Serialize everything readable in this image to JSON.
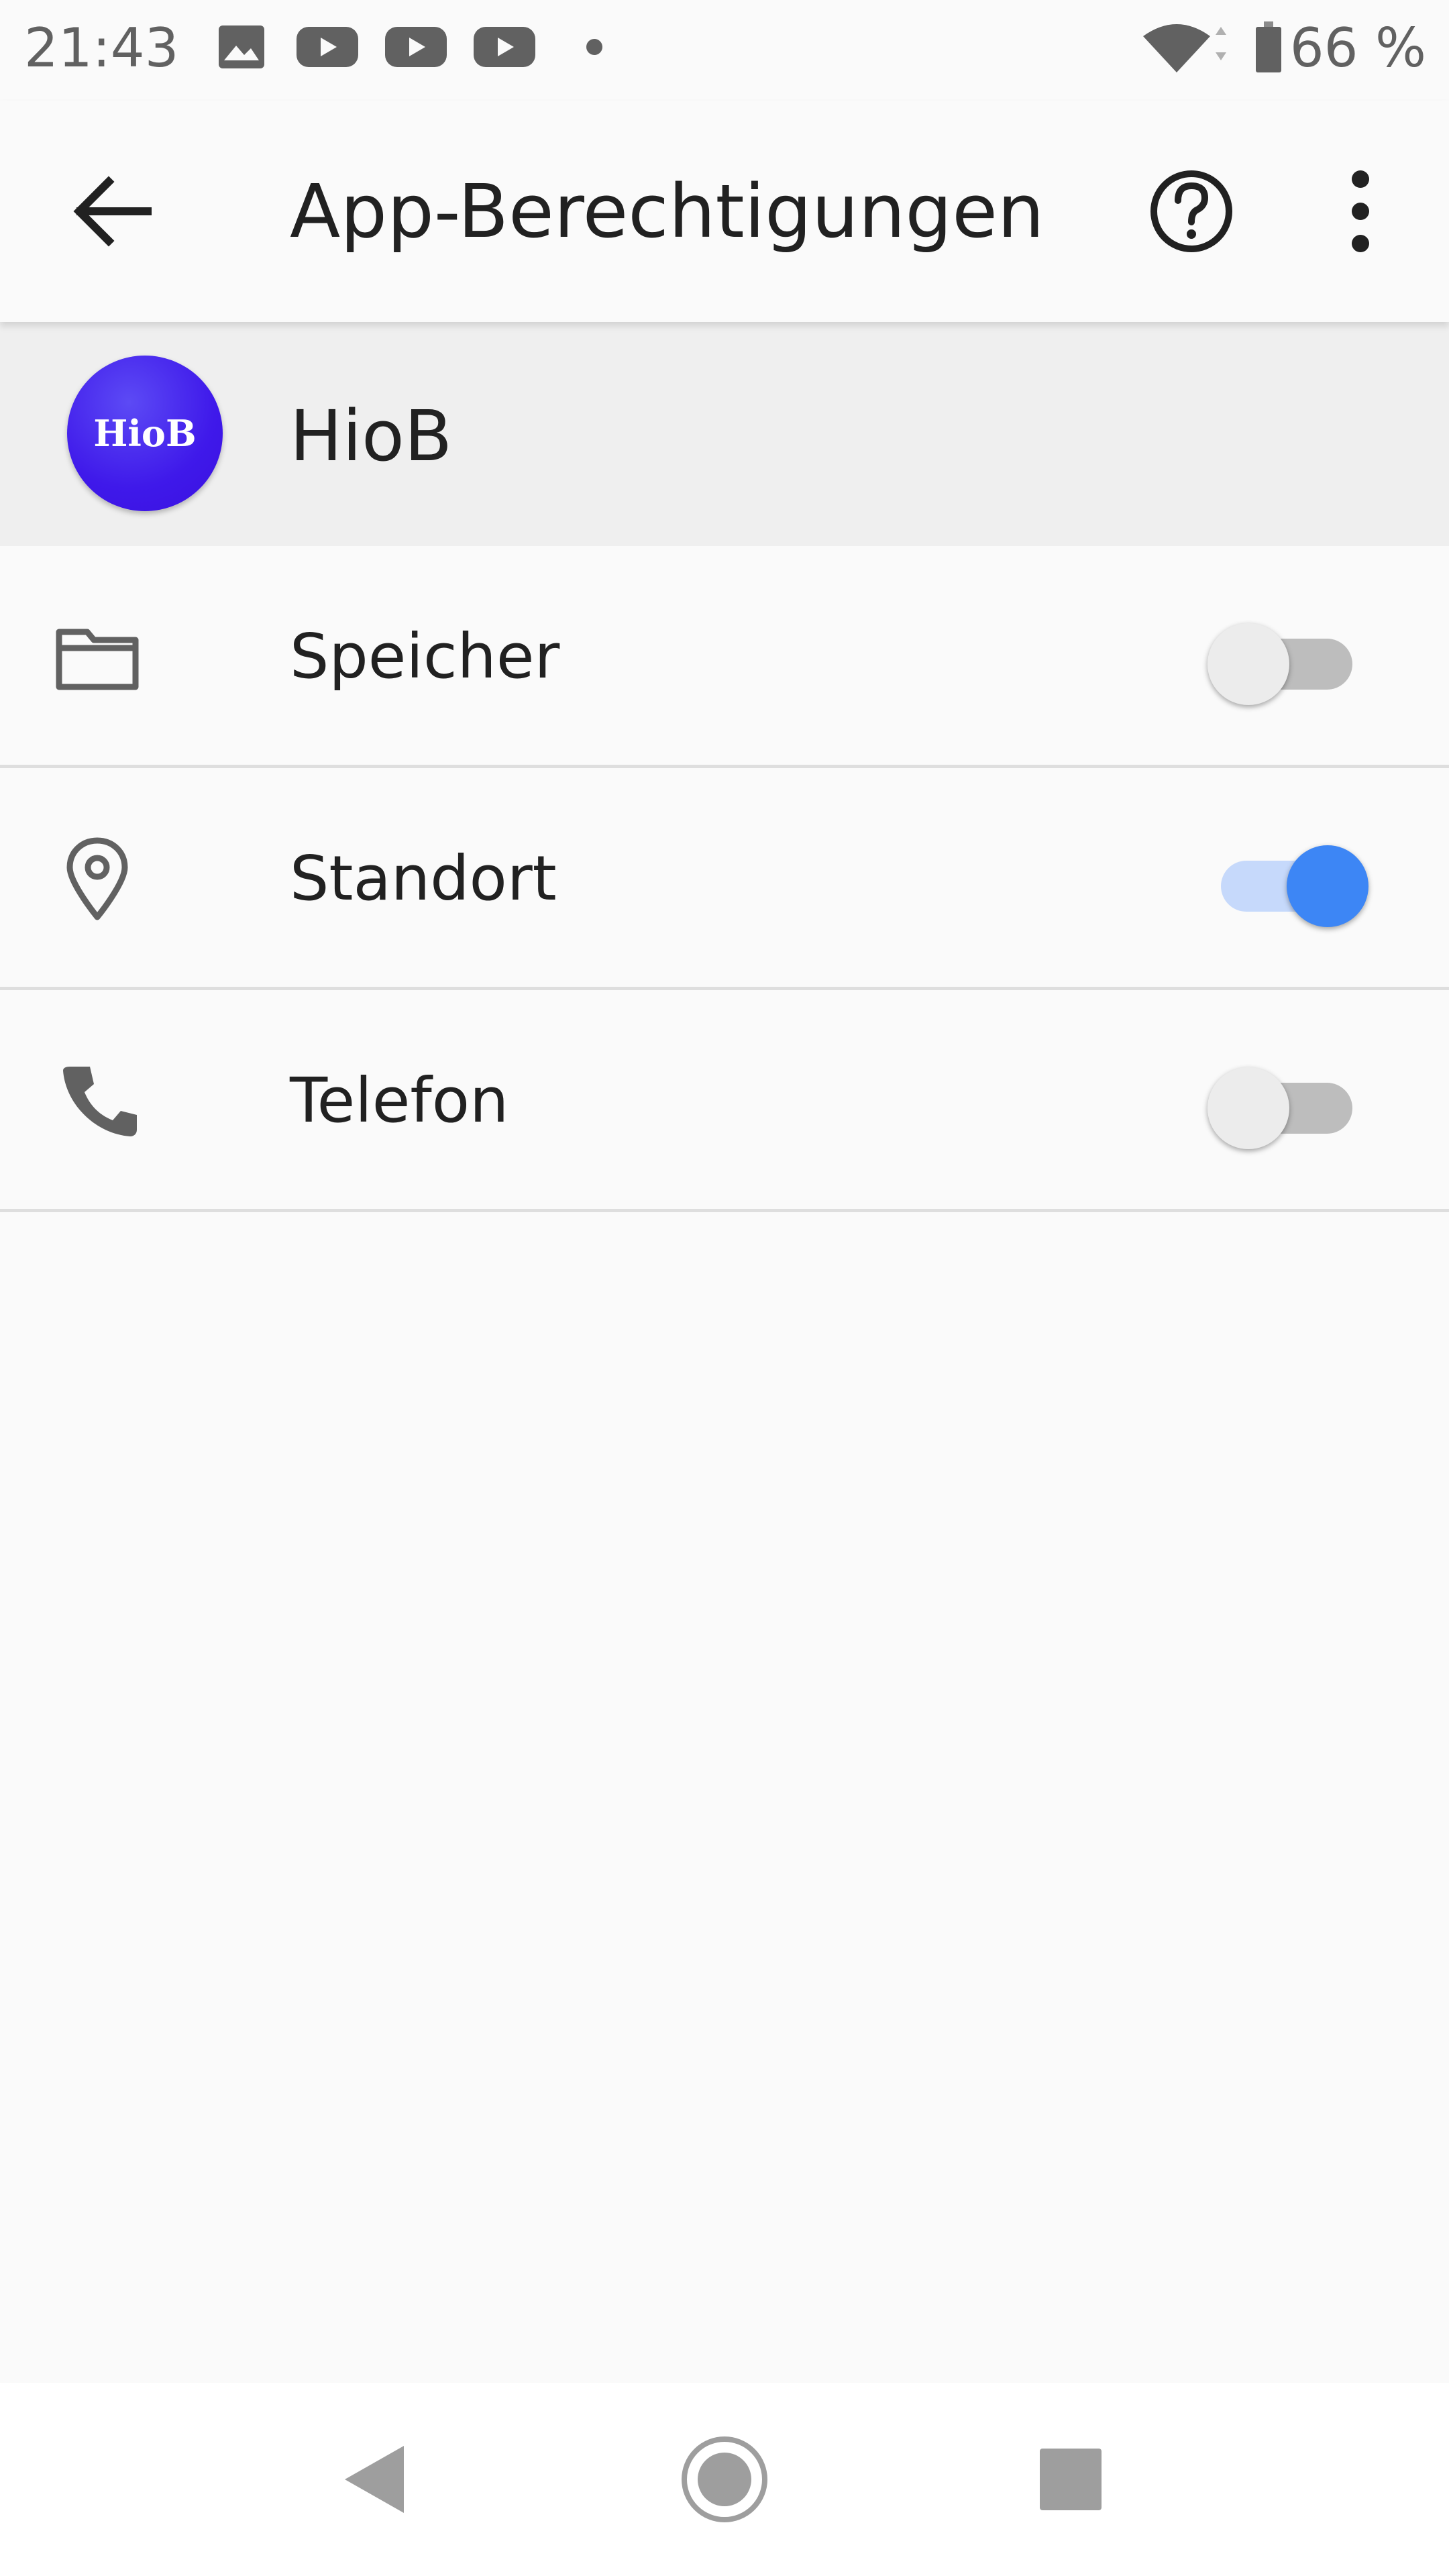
{
  "status_bar": {
    "time": "21:43",
    "battery_text": "66 %",
    "icons": [
      "image-icon",
      "youtube-icon",
      "youtube-icon",
      "youtube-icon",
      "dot-icon",
      "wifi-icon",
      "battery-icon"
    ]
  },
  "app_bar": {
    "title": "App-Berechtigungen",
    "back_icon": "arrow-back-icon",
    "help_icon": "help-circle-icon",
    "more_icon": "more-vert-icon"
  },
  "app": {
    "name": "HioB",
    "avatar_text": "HioB",
    "avatar_color": "#3f19ea"
  },
  "permissions": [
    {
      "label": "Speicher",
      "icon": "folder-icon",
      "enabled": false
    },
    {
      "label": "Standort",
      "icon": "location-pin-icon",
      "enabled": true
    },
    {
      "label": "Telefon",
      "icon": "phone-icon",
      "enabled": false
    }
  ],
  "nav_bar": {
    "buttons": [
      "nav-back-icon",
      "nav-home-icon",
      "nav-recents-icon"
    ]
  },
  "colors": {
    "accent": "#3d86f5",
    "accent_track": "#c6d9fb",
    "background": "#fafafa",
    "header_background": "#efefef"
  }
}
